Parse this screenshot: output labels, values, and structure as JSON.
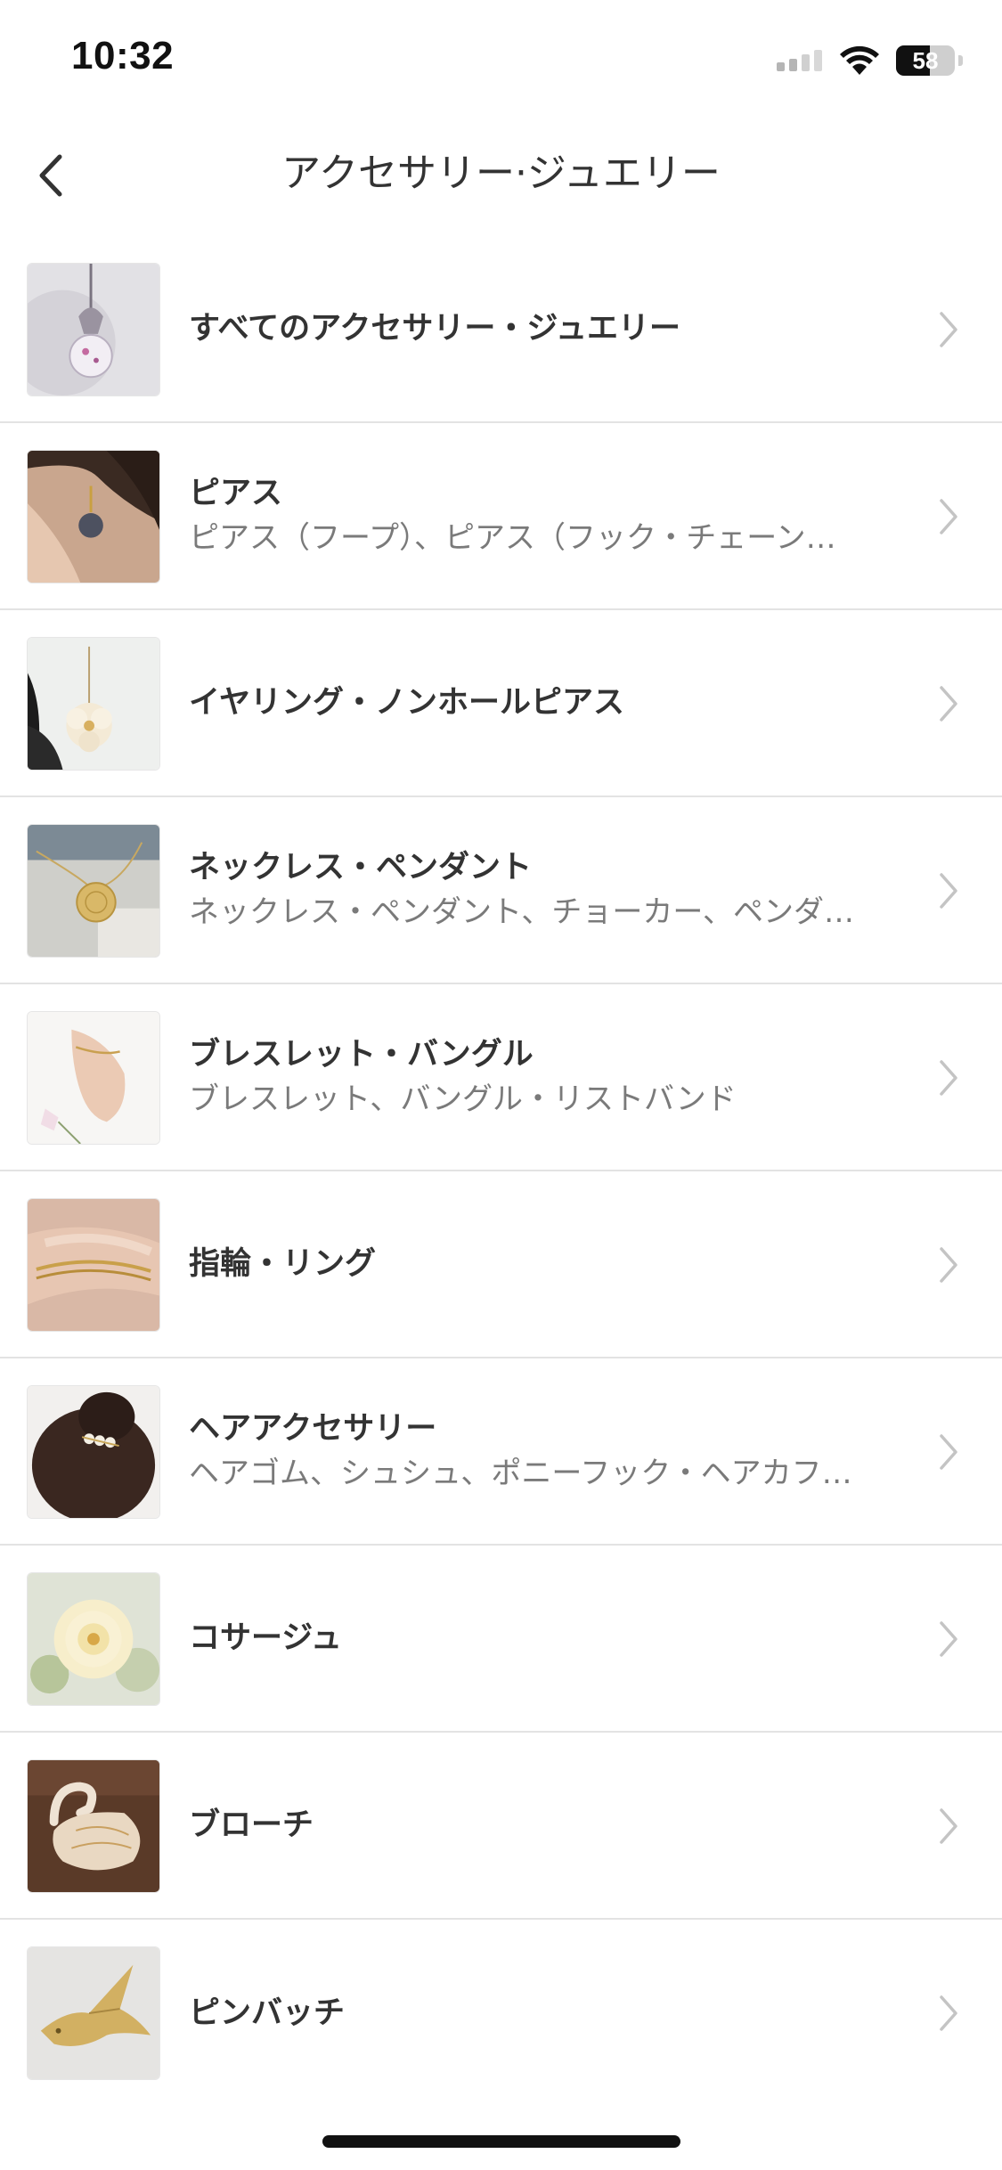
{
  "status_bar": {
    "time": "10:32",
    "battery": "58",
    "battery_level": 0.58,
    "icons": [
      "cellular-signal-icon",
      "wifi-icon",
      "battery-icon"
    ]
  },
  "nav": {
    "title": "アクセサリー·ジュエリー",
    "back_icon": "chevron-left-icon"
  },
  "categories": [
    {
      "title": "すべてのアクセサリー・ジュエリー",
      "subtitle": "",
      "thumb": "pendant-photo"
    },
    {
      "title": "ピアス",
      "subtitle": "ピアス（フープ）、ピアス（フック・チェーン…",
      "thumb": "earring-photo"
    },
    {
      "title": "イヤリング・ノンホールピアス",
      "subtitle": "",
      "thumb": "flower-earring-photo"
    },
    {
      "title": "ネックレス・ペンダント",
      "subtitle": "ネックレス・ペンダント、チョーカー、ペンダ…",
      "thumb": "necklace-photo"
    },
    {
      "title": "ブレスレット・バングル",
      "subtitle": "ブレスレット、バングル・リストバンド",
      "thumb": "bracelet-photo"
    },
    {
      "title": "指輪・リング",
      "subtitle": "",
      "thumb": "ring-photo"
    },
    {
      "title": "ヘアアクセサリー",
      "subtitle": "ヘアゴム、シュシュ、ポニーフック・ヘアカフ…",
      "thumb": "hair-accessory-photo"
    },
    {
      "title": "コサージュ",
      "subtitle": "",
      "thumb": "corsage-photo"
    },
    {
      "title": "ブローチ",
      "subtitle": "",
      "thumb": "swan-brooch-photo"
    },
    {
      "title": "ピンバッチ",
      "subtitle": "",
      "thumb": "swallow-pin-photo"
    }
  ],
  "colors": {
    "divider": "#e3e3e3",
    "title_text": "#333333",
    "subtitle_text": "#7a7a7a",
    "chevron": "#c4c4c4"
  }
}
